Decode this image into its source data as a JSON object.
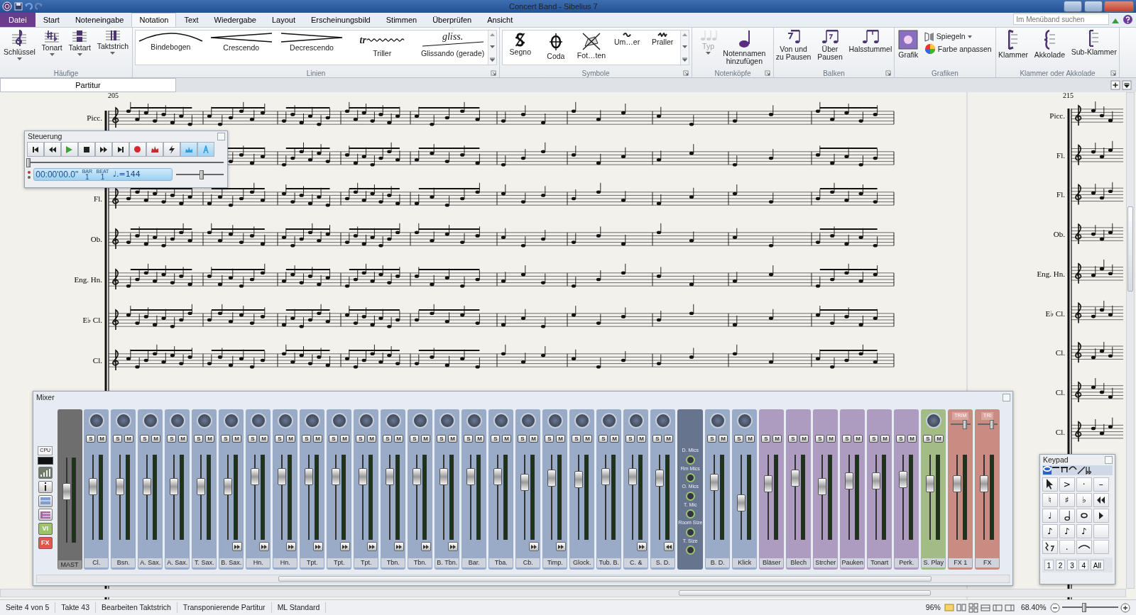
{
  "window": {
    "title": "Concert Band - Sibelius 7",
    "search": {
      "placeholder": "Im Menüband suchen"
    }
  },
  "ribbon_tabs": [
    {
      "label": "Datei",
      "kind": "file",
      "selected": false
    },
    {
      "label": "Start",
      "kind": "tab",
      "selected": false
    },
    {
      "label": "Noteneingabe",
      "kind": "tab",
      "selected": false
    },
    {
      "label": "Notation",
      "kind": "tab",
      "selected": true
    },
    {
      "label": "Text",
      "kind": "tab",
      "selected": false
    },
    {
      "label": "Wiedergabe",
      "kind": "tab",
      "selected": false
    },
    {
      "label": "Layout",
      "kind": "tab",
      "selected": false
    },
    {
      "label": "Erscheinungsbild",
      "kind": "tab",
      "selected": false
    },
    {
      "label": "Stimmen",
      "kind": "tab",
      "selected": false
    },
    {
      "label": "Überprüfen",
      "kind": "tab",
      "selected": false
    },
    {
      "label": "Ansicht",
      "kind": "tab",
      "selected": false
    }
  ],
  "ribbon_groups": [
    {
      "label": "Häufige",
      "kind": "buttons",
      "launcher": false,
      "buttons": [
        {
          "label": "Schlüssel",
          "dropdown": true
        },
        {
          "label": "Tonart",
          "dropdown": true
        },
        {
          "label": "Taktart",
          "dropdown": true
        },
        {
          "label": "Taktstrich",
          "dropdown": true
        }
      ]
    },
    {
      "label": "Linien",
      "kind": "gallery",
      "launcher": true,
      "buttons": [
        {
          "label": "Bindebogen"
        },
        {
          "label": "Crescendo"
        },
        {
          "label": "Decrescendo"
        },
        {
          "label": "Triller",
          "preview_text": "tr"
        },
        {
          "label": "Glissando (gerade)",
          "preview_text": "gliss."
        }
      ]
    },
    {
      "label": "Symbole",
      "kind": "gallery",
      "launcher": true,
      "buttons": [
        {
          "label": "Segno"
        },
        {
          "label": "Coda"
        },
        {
          "label": "Fot…ten"
        },
        {
          "label": "Um…er"
        },
        {
          "label": "Praller"
        }
      ]
    },
    {
      "label": "Notenköpfe",
      "kind": "buttons",
      "launcher": true,
      "buttons": [
        {
          "label": "Typ",
          "dropdown": true,
          "disabled": true
        },
        {
          "label": "Notennamen\nhinzufügen",
          "dropdown": false,
          "disabled": false
        }
      ]
    },
    {
      "label": "Balken",
      "kind": "buttons",
      "launcher": true,
      "buttons": [
        {
          "label": "Von und\nzu Pausen"
        },
        {
          "label": "Über\nPausen"
        },
        {
          "label": "Halsstummel"
        }
      ]
    },
    {
      "label": "Grafiken",
      "kind": "mixed",
      "launcher": false,
      "buttons": [
        {
          "label": "Grafik",
          "kind": "large"
        },
        {
          "label": "Spiegeln",
          "kind": "small",
          "dropdown": true
        },
        {
          "label": "Farbe anpassen",
          "kind": "small"
        }
      ]
    },
    {
      "label": "Klammer oder Akkolade",
      "kind": "buttons",
      "launcher": true,
      "buttons": [
        {
          "label": "Klammer"
        },
        {
          "label": "Akkolade"
        },
        {
          "label": "Sub-Klammer"
        }
      ]
    }
  ],
  "document_tabs": [
    {
      "label": "Partitur",
      "selected": true
    }
  ],
  "score": {
    "left_system": {
      "measure_number": "205",
      "staves": [
        {
          "label": "Picc."
        },
        {
          "label": "Fl."
        },
        {
          "label": "Ob."
        },
        {
          "label": "Eng. Hn."
        },
        {
          "label": "E♭ Cl."
        },
        {
          "label": "Cl."
        }
      ]
    },
    "right_system": {
      "measure_number": "215",
      "staves": [
        {
          "label": "Picc."
        },
        {
          "label": "Fl."
        },
        {
          "label": "Fl."
        },
        {
          "label": "Ob."
        },
        {
          "label": "Eng. Hn."
        },
        {
          "label": "E♭ Cl."
        },
        {
          "label": "Cl."
        },
        {
          "label": "Cl."
        },
        {
          "label": "Cl."
        }
      ]
    }
  },
  "transport": {
    "title": "Steuerung",
    "buttons": [
      {
        "selected": false
      },
      {
        "selected": false
      },
      {
        "selected": false
      },
      {
        "selected": false
      },
      {
        "selected": false
      },
      {
        "selected": false
      },
      {
        "selected": false
      },
      {
        "selected": false
      },
      {
        "selected": false
      },
      {
        "selected": true
      },
      {
        "selected": true
      }
    ],
    "position": {
      "level": 0
    },
    "time": "00:00'00.0\"",
    "bar_label": "BAR",
    "bar": "1",
    "beat_label": "BEAT",
    "beat": "1",
    "tempo": "♩.=144",
    "tempo_slider": {
      "level": 0.55
    }
  },
  "mixer": {
    "title": "Mixer",
    "cpu_label": "CPU",
    "side_buttons": [
      {
        "label": "VI",
        "color": "#9cc46a"
      },
      {
        "label": "FX",
        "color": "#e0584c"
      }
    ],
    "master": {
      "label": "MAST",
      "level": 0.62
    },
    "channels": [
      {
        "name": "Cl.",
        "kind": "instrument",
        "color": "#9aabc8",
        "level": 0.66,
        "solo": "S",
        "mute": "M"
      },
      {
        "name": "Bsn.",
        "kind": "instrument",
        "color": "#9aabc8",
        "level": 0.66,
        "solo": "S",
        "mute": "M"
      },
      {
        "name": "A. Sax.",
        "kind": "instrument",
        "color": "#9aabc8",
        "level": 0.66,
        "solo": "S",
        "mute": "M"
      },
      {
        "name": "A. Sax.",
        "kind": "instrument",
        "color": "#9aabc8",
        "level": 0.66,
        "solo": "S",
        "mute": "M"
      },
      {
        "name": "T. Sax.",
        "kind": "instrument",
        "color": "#9aabc8",
        "level": 0.66,
        "solo": "S",
        "mute": "M"
      },
      {
        "name": "B. Sax.",
        "kind": "instrument",
        "color": "#9aabc8",
        "level": 0.66,
        "solo": "S",
        "mute": "M",
        "forward_button": true
      },
      {
        "name": "Hn.",
        "kind": "instrument",
        "color": "#9aabc8",
        "level": 0.8,
        "solo": "S",
        "mute": "M",
        "forward_button": true
      },
      {
        "name": "Hn.",
        "kind": "instrument",
        "color": "#9aabc8",
        "level": 0.8,
        "solo": "S",
        "mute": "M",
        "forward_button": true
      },
      {
        "name": "Tpt.",
        "kind": "instrument",
        "color": "#9aabc8",
        "level": 0.8,
        "solo": "S",
        "mute": "M",
        "forward_button": true
      },
      {
        "name": "Tpt.",
        "kind": "instrument",
        "color": "#9aabc8",
        "level": 0.8,
        "solo": "S",
        "mute": "M",
        "forward_button": true
      },
      {
        "name": "Tpt.",
        "kind": "instrument",
        "color": "#9aabc8",
        "level": 0.8,
        "solo": "S",
        "mute": "M",
        "forward_button": true
      },
      {
        "name": "Tbn.",
        "kind": "instrument",
        "color": "#9aabc8",
        "level": 0.8,
        "solo": "S",
        "mute": "M",
        "forward_button": true
      },
      {
        "name": "Tbn.",
        "kind": "instrument",
        "color": "#9aabc8",
        "level": 0.8,
        "solo": "S",
        "mute": "M",
        "forward_button": true
      },
      {
        "name": "B. Tbn.",
        "kind": "instrument",
        "color": "#9aabc8",
        "level": 0.8,
        "solo": "S",
        "mute": "M",
        "forward_button": true
      },
      {
        "name": "Bar.",
        "kind": "instrument",
        "color": "#9aabc8",
        "level": 0.8,
        "solo": "S",
        "mute": "M"
      },
      {
        "name": "Tba.",
        "kind": "instrument",
        "color": "#9aabc8",
        "level": 0.8,
        "solo": "S",
        "mute": "M"
      },
      {
        "name": "Cb.",
        "kind": "instrument",
        "color": "#9aabc8",
        "level": 0.72,
        "solo": "S",
        "mute": "M",
        "forward_button": true
      },
      {
        "name": "Timp.",
        "kind": "instrument",
        "color": "#9aabc8",
        "level": 0.78,
        "solo": "S",
        "mute": "M",
        "forward_button": true
      },
      {
        "name": "Glock.",
        "kind": "instrument",
        "color": "#9aabc8",
        "level": 0.76,
        "solo": "S",
        "mute": "M"
      },
      {
        "name": "Tub. B.",
        "kind": "instrument",
        "color": "#9aabc8",
        "level": 0.8,
        "solo": "S",
        "mute": "M"
      },
      {
        "name": "C. &",
        "kind": "instrument",
        "color": "#9aabc8",
        "level": 0.8,
        "solo": "S",
        "mute": "M",
        "forward_button": true
      },
      {
        "name": "S. D.",
        "kind": "instrument",
        "color": "#9aabc8",
        "level": 0.78,
        "solo": "S",
        "mute": "M",
        "back_button": true
      },
      {
        "kind": "mics",
        "knobs": [
          "D. Mics",
          "Rm Mics",
          "O. Mics",
          "T. Mic",
          "Room Size",
          "T. Size"
        ]
      },
      {
        "name": "B. D.",
        "kind": "instrument",
        "color": "#9aabc8",
        "level": 0.72,
        "solo": "S",
        "mute": "M"
      },
      {
        "name": "Klick",
        "kind": "instrument",
        "color": "#9aabc8",
        "level": 0.42,
        "solo": "S",
        "mute": "M"
      },
      {
        "name": "Bläser",
        "kind": "group",
        "color": "#ad9cc0",
        "level": 0.7,
        "solo": "S",
        "mute": "M"
      },
      {
        "name": "Blech",
        "kind": "group",
        "color": "#ad9cc0",
        "level": 0.78,
        "solo": "S",
        "mute": "M"
      },
      {
        "name": "Strcher",
        "kind": "group",
        "color": "#ad9cc0",
        "level": 0.66,
        "solo": "S",
        "mute": "M"
      },
      {
        "name": "Pauken",
        "kind": "group",
        "color": "#ad9cc0",
        "level": 0.74,
        "solo": "S",
        "mute": "M"
      },
      {
        "name": "Tonart",
        "kind": "group",
        "color": "#ad9cc0",
        "level": 0.74,
        "solo": "S",
        "mute": "M"
      },
      {
        "name": "Perk.",
        "kind": "group",
        "color": "#ad9cc0",
        "level": 0.76,
        "solo": "S",
        "mute": "M"
      },
      {
        "name": "S. Play",
        "kind": "instrument",
        "color": "#a3bb84",
        "level": 0.7,
        "solo": "S",
        "mute": "M"
      },
      {
        "name": "FX 1",
        "kind": "fx",
        "color": "#c98c82",
        "level": 0.7,
        "trim": {
          "label": "TRIM",
          "level": 0.75
        }
      },
      {
        "name": "FX",
        "kind": "fx",
        "color": "#c98c82",
        "level": 0.7,
        "trim": {
          "label": "TRI",
          "level": 0.75
        }
      }
    ]
  },
  "keypad": {
    "title": "Keypad",
    "tabs": [
      {
        "selected": true
      },
      {
        "selected": false
      },
      {
        "selected": false
      },
      {
        "selected": false
      },
      {
        "selected": false
      },
      {
        "selected": false
      }
    ],
    "keys": [
      {
        "kind": "icon"
      },
      {
        "kind": "glyph",
        "glyph": ">"
      },
      {
        "kind": "glyph",
        "glyph": "·"
      },
      {
        "kind": "glyph",
        "glyph": "–"
      },
      {
        "kind": "glyph",
        "glyph": "♮"
      },
      {
        "kind": "glyph",
        "glyph": "♯"
      },
      {
        "kind": "glyph",
        "glyph": "♭"
      },
      {
        "kind": "icon"
      },
      {
        "kind": "glyph",
        "glyph": "♩"
      },
      {
        "kind": "icon"
      },
      {
        "kind": "icon"
      },
      {
        "kind": "icon"
      },
      {
        "kind": "glyph",
        "glyph": "♪"
      },
      {
        "kind": "glyph",
        "glyph": "♪"
      },
      {
        "kind": "glyph",
        "glyph": "♪"
      },
      {
        "kind": "blank"
      },
      {
        "kind": "icon"
      },
      {
        "kind": "glyph",
        "glyph": "."
      },
      {
        "kind": "icon"
      },
      {
        "kind": "blank"
      }
    ],
    "layouts": [
      {
        "label": "1"
      },
      {
        "label": "2"
      },
      {
        "label": "3"
      },
      {
        "label": "4"
      },
      {
        "label": "All"
      }
    ]
  },
  "status_bar": {
    "items": [
      "Seite 4 von 5",
      "Takte 43",
      "Bearbeiten Taktstrich",
      "Transponierende Partitur",
      "ML Standard"
    ],
    "zoom": "96%",
    "zoom_percent": "68.40%",
    "zoom_slider": {
      "level": 0.4
    }
  }
}
